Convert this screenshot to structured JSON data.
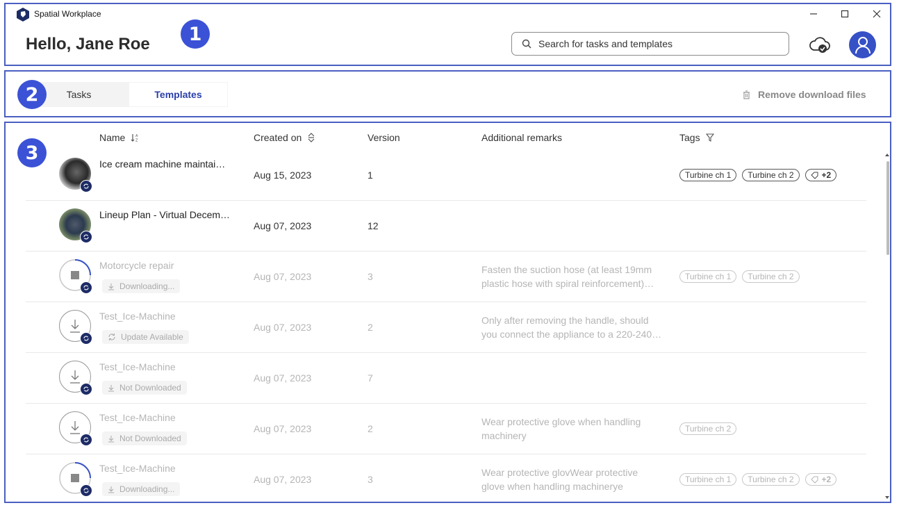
{
  "app": {
    "title": "Spatial Workplace"
  },
  "header": {
    "greeting": "Hello, Jane Roe",
    "search_placeholder": "Search for tasks and templates"
  },
  "badges": [
    "1",
    "2",
    "3"
  ],
  "tabs": [
    {
      "label": "Tasks",
      "active": false
    },
    {
      "label": "Templates",
      "active": true
    }
  ],
  "remove_download_label": "Remove download files",
  "columns": {
    "name": "Name",
    "created_on": "Created on",
    "version": "Version",
    "remarks": "Additional remarks",
    "tags": "Tags"
  },
  "rows": [
    {
      "name": "Ice cream machine maintai…",
      "date": "Aug 15, 2023",
      "version": "1",
      "remarks": "",
      "tags": [
        "Turbine ch 1",
        "Turbine ch 2"
      ],
      "more": "+2",
      "status": ""
    },
    {
      "name": "Lineup Plan - Virtual Decem…",
      "date": "Aug 07, 2023",
      "version": "12",
      "remarks": "",
      "tags": [],
      "more": "",
      "status": ""
    },
    {
      "name": "Motorcycle repair",
      "date": "Aug 07, 2023",
      "version": "3",
      "remarks": "Fasten the suction hose (at least 19mm plastic hose with spiral reinforcement)…",
      "tags": [
        "Turbine ch 1",
        "Turbine ch 2"
      ],
      "more": "",
      "status": "Downloading..."
    },
    {
      "name": "Test_Ice-Machine",
      "date": "Aug 07, 2023",
      "version": "2",
      "remarks": "Only after removing the handle, should you connect the appliance to a 220-240…",
      "tags": [],
      "more": "",
      "status": "Update Available"
    },
    {
      "name": "Test_Ice-Machine",
      "date": "Aug 07, 2023",
      "version": "7",
      "remarks": "",
      "tags": [],
      "more": "",
      "status": "Not Downloaded"
    },
    {
      "name": "Test_Ice-Machine",
      "date": "Aug 07, 2023",
      "version": "2",
      "remarks": "Wear protective glove when handling machinery",
      "tags": [
        "Turbine ch 2"
      ],
      "more": "",
      "status": "Not Downloaded"
    },
    {
      "name": "Test_Ice-Machine",
      "date": "Aug 07, 2023",
      "version": "3",
      "remarks": "Wear protective glovWear protective glove when handling machinerye",
      "tags": [
        "Turbine ch 1",
        "Turbine ch 2"
      ],
      "more": "+2",
      "status": "Downloading..."
    }
  ],
  "colors": {
    "accent": "#3b52d6",
    "frame": "#4a5fc1",
    "active_tab": "#2a3fa8",
    "sync_badge": "#1d2c66"
  }
}
